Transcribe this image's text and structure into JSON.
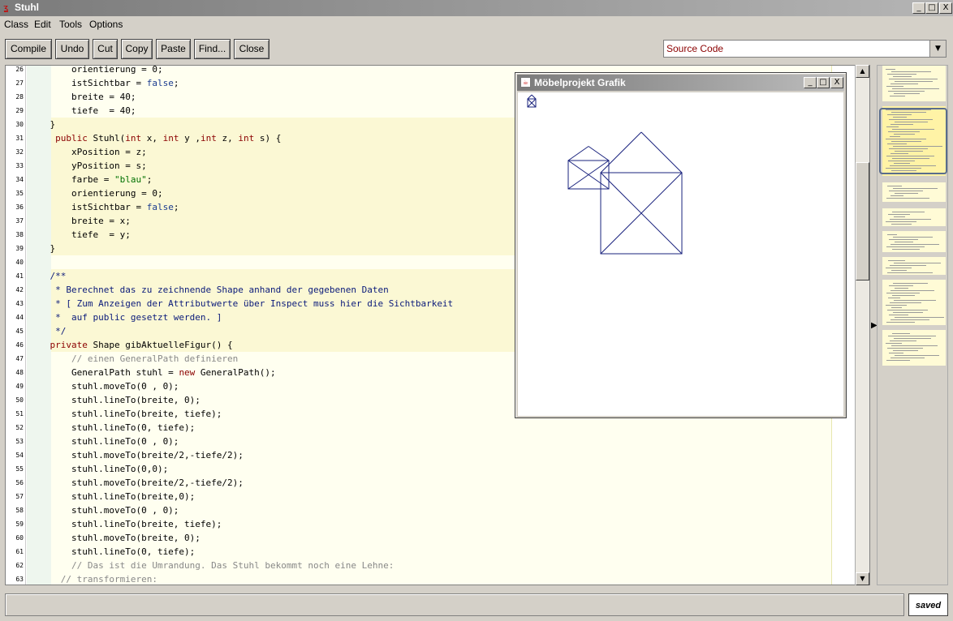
{
  "window": {
    "title": "Stuhl",
    "controls": [
      "_",
      "□",
      "X"
    ]
  },
  "menu": [
    "Class",
    "Edit",
    "Tools",
    "Options"
  ],
  "toolbar": {
    "buttons": [
      "Compile",
      "Undo",
      "Cut",
      "Copy",
      "Paste",
      "Find...",
      "Close"
    ],
    "view_select": "Source Code"
  },
  "editor": {
    "lines": [
      {
        "n": "26",
        "text": "        orientierung = 0;"
      },
      {
        "n": "27",
        "text": "        istSichtbar = false;"
      },
      {
        "n": "28",
        "text": "        breite = 40;"
      },
      {
        "n": "29",
        "text": "        tiefe  = 40;"
      },
      {
        "n": "30",
        "text": "    }"
      },
      {
        "n": "31",
        "text": "     public Stuhl(int x, int y ,int z, int s) {"
      },
      {
        "n": "32",
        "text": "        xPosition = z;"
      },
      {
        "n": "33",
        "text": "        yPosition = s;"
      },
      {
        "n": "34",
        "text": "        farbe = \"blau\";"
      },
      {
        "n": "35",
        "text": "        orientierung = 0;"
      },
      {
        "n": "36",
        "text": "        istSichtbar = false;"
      },
      {
        "n": "37",
        "text": "        breite = x;"
      },
      {
        "n": "38",
        "text": "        tiefe  = y;"
      },
      {
        "n": "39",
        "text": "    }"
      },
      {
        "n": "40",
        "text": ""
      },
      {
        "n": "41",
        "text": "    /**"
      },
      {
        "n": "42",
        "text": "     * Berechnet das zu zeichnende Shape anhand der gegebenen Daten"
      },
      {
        "n": "43",
        "text": "     * [ Zum Anzeigen der Attributwerte über Inspect muss hier die Sichtbarkeit"
      },
      {
        "n": "44",
        "text": "     *  auf public gesetzt werden. ]"
      },
      {
        "n": "45",
        "text": "     */"
      },
      {
        "n": "46",
        "text": "    private Shape gibAktuelleFigur() {"
      },
      {
        "n": "47",
        "text": "        // einen GeneralPath definieren"
      },
      {
        "n": "48",
        "text": "        GeneralPath stuhl = new GeneralPath();"
      },
      {
        "n": "49",
        "text": "        stuhl.moveTo(0 , 0);"
      },
      {
        "n": "50",
        "text": "        stuhl.lineTo(breite, 0);"
      },
      {
        "n": "51",
        "text": "        stuhl.lineTo(breite, tiefe);"
      },
      {
        "n": "52",
        "text": "        stuhl.lineTo(0, tiefe);"
      },
      {
        "n": "53",
        "text": "        stuhl.lineTo(0 , 0);"
      },
      {
        "n": "54",
        "text": "        stuhl.moveTo(breite/2,-tiefe/2);"
      },
      {
        "n": "55",
        "text": "        stuhl.lineTo(0,0);"
      },
      {
        "n": "56",
        "text": "        stuhl.moveTo(breite/2,-tiefe/2);"
      },
      {
        "n": "57",
        "text": "        stuhl.lineTo(breite,0);"
      },
      {
        "n": "58",
        "text": "        stuhl.moveTo(0 , 0);"
      },
      {
        "n": "59",
        "text": "        stuhl.lineTo(breite, tiefe);"
      },
      {
        "n": "60",
        "text": "        stuhl.moveTo(breite, 0);"
      },
      {
        "n": "61",
        "text": "        stuhl.lineTo(0, tiefe);"
      },
      {
        "n": "62",
        "text": "        // Das ist die Umrandung. Das Stuhl bekommt noch eine Lehne:"
      },
      {
        "n": "63",
        "text": "      // transformieren:"
      }
    ]
  },
  "graphic_window": {
    "title": "Möbelprojekt Grafik",
    "stroke_color": "#1a237e"
  },
  "status": {
    "message": "",
    "saved_label": "saved"
  }
}
